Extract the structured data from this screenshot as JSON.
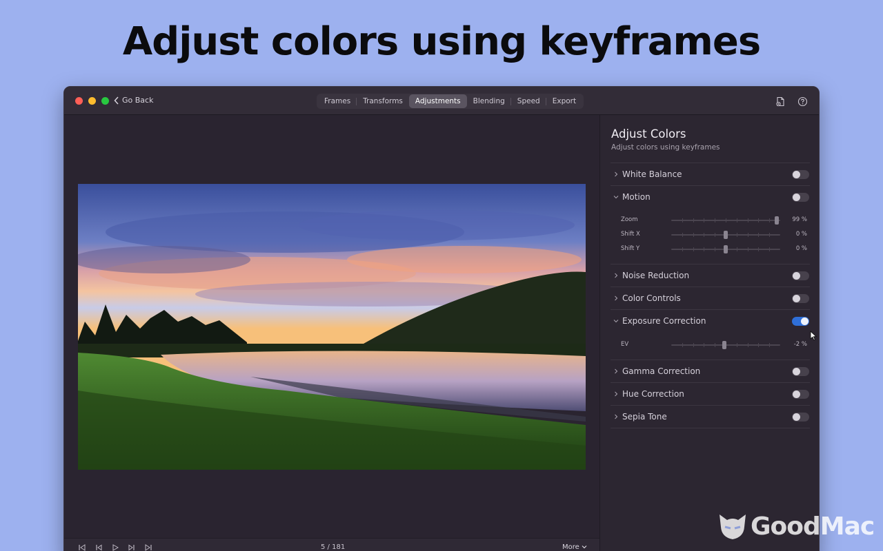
{
  "headline": "Adjust colors using keyframes",
  "window": {
    "traffic_lights": {
      "close": "#fe5f57",
      "minimize": "#febc2e",
      "zoom": "#28c840"
    },
    "back_label": "Go Back",
    "tabs": [
      {
        "label": "Frames",
        "active": false
      },
      {
        "label": "Transforms",
        "active": false
      },
      {
        "label": "Adjustments",
        "active": true
      },
      {
        "label": "Blending",
        "active": false
      },
      {
        "label": "Speed",
        "active": false
      },
      {
        "label": "Export",
        "active": false
      }
    ],
    "toolbar_icons": [
      "document-badge-icon",
      "help-icon"
    ]
  },
  "playback": {
    "frame_counter": "5 / 181",
    "more_label": "More",
    "buttons": [
      "skip-to-start-icon",
      "step-back-icon",
      "play-icon",
      "step-forward-icon",
      "skip-to-end-icon"
    ]
  },
  "panel": {
    "title": "Adjust Colors",
    "subtitle": "Adjust colors using keyframes",
    "sections": [
      {
        "label": "White Balance",
        "expanded": false,
        "enabled": false
      },
      {
        "label": "Motion",
        "expanded": true,
        "enabled": false,
        "sliders": [
          {
            "label": "Zoom",
            "value": "99 %",
            "fraction": 0.99
          },
          {
            "label": "Shift X",
            "value": "0 %",
            "fraction": 0.5
          },
          {
            "label": "Shift Y",
            "value": "0 %",
            "fraction": 0.5
          }
        ]
      },
      {
        "label": "Noise Reduction",
        "expanded": false,
        "enabled": false
      },
      {
        "label": "Color Controls",
        "expanded": false,
        "enabled": false
      },
      {
        "label": "Exposure Correction",
        "expanded": true,
        "enabled": true,
        "sliders": [
          {
            "label": "EV",
            "value": "-2 %",
            "fraction": 0.49
          }
        ]
      },
      {
        "label": "Gamma Correction",
        "expanded": false,
        "enabled": false
      },
      {
        "label": "Hue Correction",
        "expanded": false,
        "enabled": false
      },
      {
        "label": "Sepia Tone",
        "expanded": false,
        "enabled": false
      }
    ]
  },
  "accent_color": "#2f6fd8",
  "watermark": "GoodMac"
}
